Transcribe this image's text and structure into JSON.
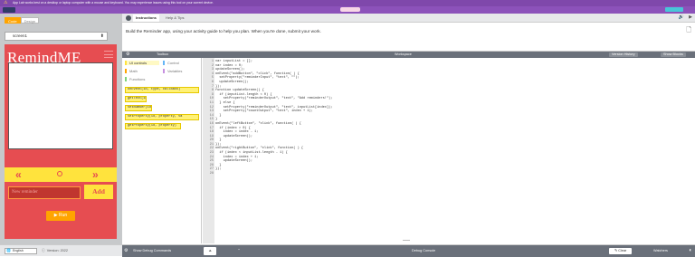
{
  "banner": {
    "text": "App Lab works best on a desktop or laptop computer with a mouse and keyboard. You may experience issues using this tool on your current device."
  },
  "left": {
    "mode_code": "Code",
    "mode_design": "Design",
    "screen_select": "screen1",
    "app_title": "RemindME",
    "prev_label": "«",
    "next_label": "»",
    "input_placeholder": "New reminder",
    "add_label": "Add",
    "run_label": "Run"
  },
  "instructions": {
    "tab_active": "Instructions",
    "tab_help": "Help & Tips",
    "text": "Build the Reminder app, using your activity guide to help you plan. When you're done, submit your work."
  },
  "workspace": {
    "toolbox_label": "Toolbox",
    "workspace_label": "Workspace",
    "version_history": "Version History",
    "show_blocks": "Show Blocks"
  },
  "toolbox": {
    "categories": [
      "UI controls",
      "Control",
      "Math",
      "Variables",
      "Functions"
    ],
    "blocks": [
      "onEvent(id, type, callback)",
      "getText(id)",
      "setNumber(id)",
      "setProperty(id, property, va",
      "getProperty(id, property)"
    ]
  },
  "code_lines": [
    [
      "1",
      "var inputList = [];"
    ],
    [
      "2",
      "var index = 0;"
    ],
    [
      "3",
      "updateScreen();"
    ],
    [
      "4",
      "onEvent(\"addButton\", \"click\", function( ) {"
    ],
    [
      "5",
      "  setProperty(\"reminderInput\", \"text\", \"\");"
    ],
    [
      "6",
      "  updateScreen();"
    ],
    [
      "7",
      "});"
    ],
    [
      "8",
      "function updateScreen() {"
    ],
    [
      "9",
      "  if (inputList.length < 0) {"
    ],
    [
      "10",
      "    setProperty(\"reminderOutput\", \"text\", \"Add reminders!\");"
    ],
    [
      "11",
      "  } else {"
    ],
    [
      "12",
      "    setProperty(\"reminderOutput\", \"text\", inputList[index]);"
    ],
    [
      "13",
      "    setProperty(\"countOutput\", \"text\", index + 1);"
    ],
    [
      "14",
      "  }"
    ],
    [
      "15",
      "}"
    ],
    [
      "16",
      "onEvent(\"leftButton\", \"click\", function( ) {"
    ],
    [
      "17",
      "  if (index > 0) {"
    ],
    [
      "18",
      "    index = index - 1;"
    ],
    [
      "19",
      "    updateScreen();"
    ],
    [
      "20",
      "  }"
    ],
    [
      "21",
      "});"
    ],
    [
      "22",
      "onEvent(\"rightButton\", \"click\", function( ) {"
    ],
    [
      "23",
      "  if (index < inputList.length - 1) {"
    ],
    [
      "24",
      "    index = index + 1;"
    ],
    [
      "25",
      "    updateScreen();"
    ],
    [
      "26",
      "  }"
    ],
    [
      "27",
      "});"
    ],
    [
      "28",
      ""
    ]
  ],
  "bottom": {
    "language": "English",
    "version": "Version: 2022",
    "show_debug": "Show Debug Commands",
    "debug_console": "Debug Console",
    "clear_label": "Clear",
    "watchers": "Watchers"
  },
  "colors": {
    "header_purple": "#8c52ba",
    "app_red": "#e64d51",
    "app_yellow": "#ffe33d",
    "run_orange": "#ffa400"
  }
}
